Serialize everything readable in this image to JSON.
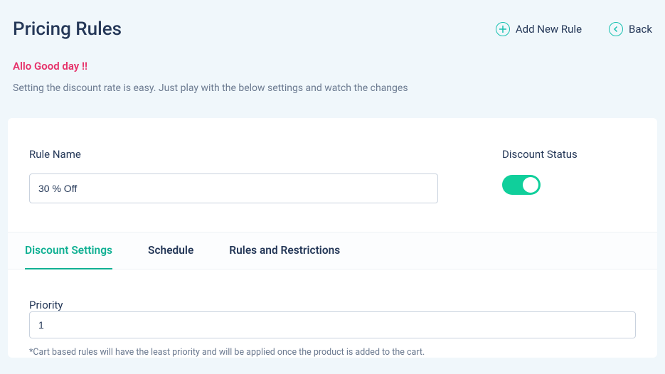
{
  "header": {
    "title": "Pricing Rules",
    "add_label": "Add New Rule",
    "back_label": "Back"
  },
  "greeting": "Allo Good day !!",
  "subtext": "Setting the discount rate is easy. Just play with the below settings and watch the changes",
  "form": {
    "rule_name_label": "Rule Name",
    "rule_name_value": "30 % Off",
    "discount_status_label": "Discount Status",
    "discount_status_on": true
  },
  "tabs": [
    {
      "label": "Discount Settings",
      "active": true
    },
    {
      "label": "Schedule",
      "active": false
    },
    {
      "label": "Rules and Restrictions",
      "active": false
    }
  ],
  "priority": {
    "label": "Priority",
    "value": "1",
    "hint": "*Cart based rules will have the least priority and will be applied once the product is added to the cart."
  }
}
